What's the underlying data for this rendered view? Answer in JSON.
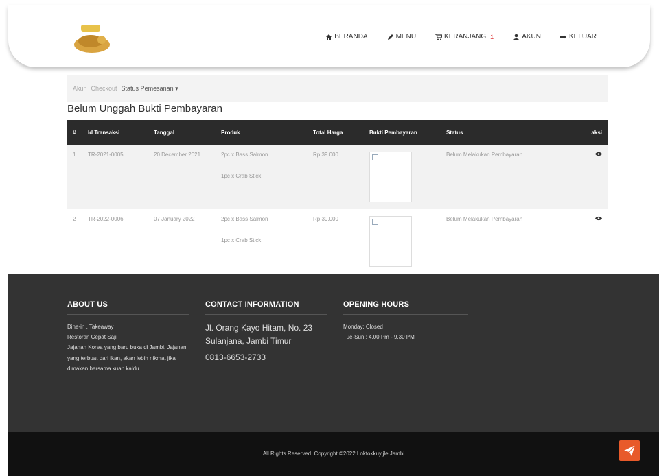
{
  "navbar": {
    "items": [
      {
        "label": "BERANDA",
        "icon": "home-icon"
      },
      {
        "label": "MENU",
        "icon": "pencil-icon"
      },
      {
        "label": "KERANJANG",
        "icon": "cart-icon"
      },
      {
        "label": "AKUN",
        "icon": "user-icon"
      },
      {
        "label": "KELUAR",
        "icon": "logout-icon"
      }
    ],
    "cart_count": "1"
  },
  "breadcrumb": [
    "Akun",
    "Checkout",
    "Status Pemesanan ▾"
  ],
  "page_title": "Belum Unggah Bukti Pembayaran",
  "table": {
    "headers": [
      "#",
      "Id Transaksi",
      "Tanggal",
      "Produk",
      "Total Harga",
      "Bukti Pembayaran",
      "Status",
      "aksi"
    ],
    "rows": [
      {
        "no": "1",
        "id": "TR-2021-0005",
        "date": "20 December 2021",
        "products": [
          "2pc x Bass Salmon",
          "1pc x Crab Stick"
        ],
        "total": "Rp 39.000",
        "status": "Belum Melakukan Pembayaran"
      },
      {
        "no": "2",
        "id": "TR-2022-0006",
        "date": "07 January 2022",
        "products": [
          "2pc x Bass Salmon",
          "1pc x Crab Stick"
        ],
        "total": "Rp 39.000",
        "status": "Belum Melakukan Pembayaran"
      }
    ]
  },
  "footer": {
    "about": {
      "title": "ABOUT US",
      "lines": [
        "Dine-in , Takeaway",
        "Restoran Cepat Saji",
        "Jajanan Korea yang baru buka di Jambi. Jajanan yang terbuat dari ikan, akan lebih nikmat jika dimakan bersama kuah kaldu."
      ]
    },
    "contact": {
      "title": "CONTACT INFORMATION",
      "address": "Jl. Orang Kayo Hitam, No. 23 Sulanjana, Jambi Timur",
      "phone": "0813-6653-2733"
    },
    "hours": {
      "title": "OPENING HOURS",
      "lines": [
        "Monday: Closed",
        "Tue-Sun : 4.00 Pm - 9.30 PM"
      ]
    }
  },
  "copyright": "All Rights Reserved. Copyright ©2022 Loktokkuy,jle Jambi",
  "colors": {
    "accent": "#e85a2a",
    "dark": "#333333",
    "table_head": "#2b2b2b"
  }
}
